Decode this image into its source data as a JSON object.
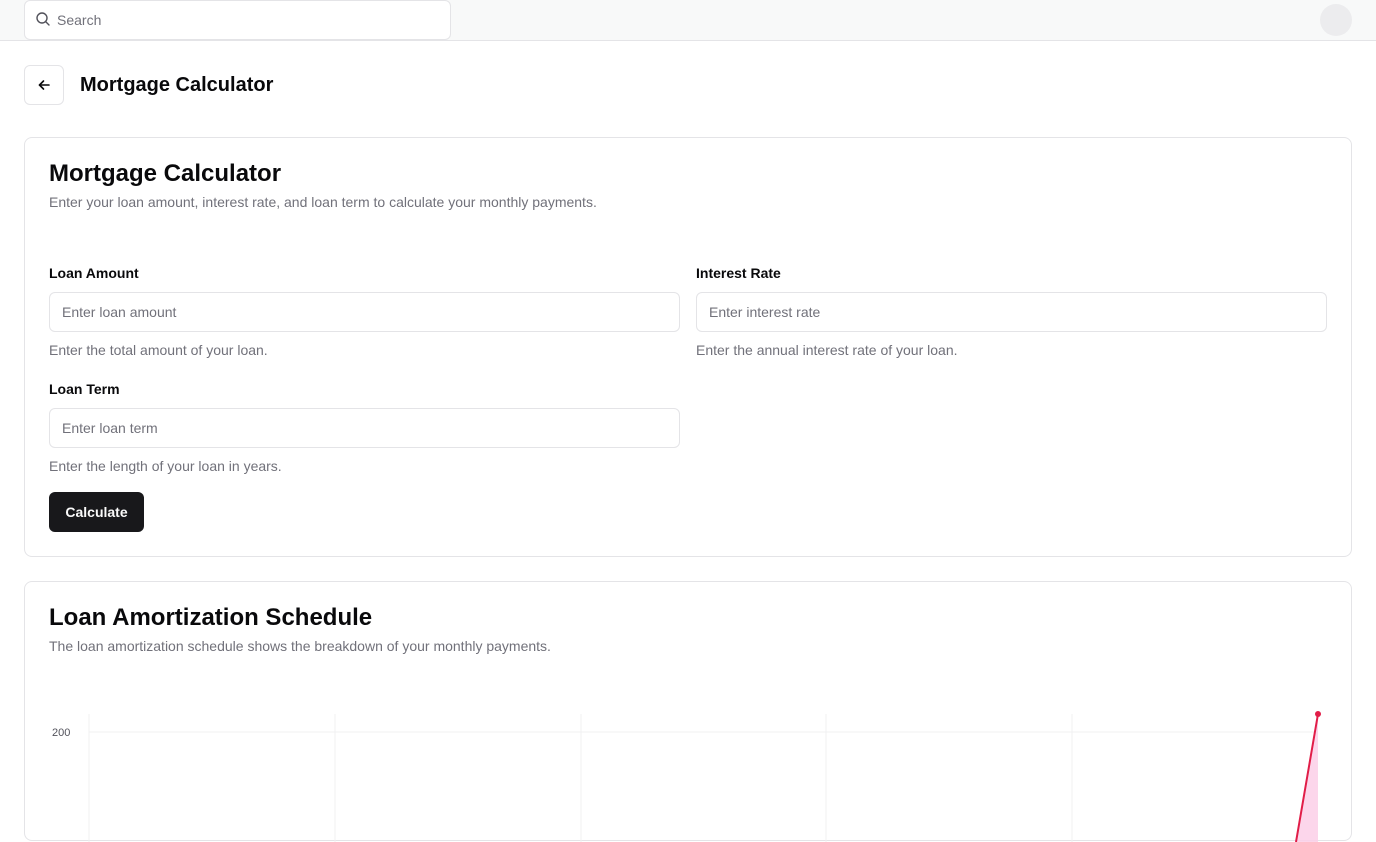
{
  "topbar": {
    "search_placeholder": "Search"
  },
  "header": {
    "title": "Mortgage Calculator"
  },
  "calculator": {
    "title": "Mortgage Calculator",
    "description": "Enter your loan amount, interest rate, and loan term to calculate your monthly payments.",
    "fields": {
      "loan_amount": {
        "label": "Loan Amount",
        "placeholder": "Enter loan amount",
        "value": "",
        "hint": "Enter the total amount of your loan."
      },
      "interest_rate": {
        "label": "Interest Rate",
        "placeholder": "Enter interest rate",
        "value": "",
        "hint": "Enter the annual interest rate of your loan."
      },
      "loan_term": {
        "label": "Loan Term",
        "placeholder": "Enter loan term",
        "value": "",
        "hint": "Enter the length of your loan in years."
      }
    },
    "calculate_label": "Calculate"
  },
  "schedule": {
    "title": "Loan Amortization Schedule",
    "description": "The loan amortization schedule shows the breakdown of your monthly payments."
  },
  "colors": {
    "primary": "#18181b",
    "muted": "#71717a",
    "border": "#e4e4e7",
    "series": "#e11d48",
    "series_fill": "#fbcfe8"
  },
  "icons": {
    "search": "search-icon",
    "back": "arrow-left-icon"
  },
  "chart_data": {
    "type": "area",
    "title": "",
    "xlabel": "",
    "ylabel": "",
    "y_ticks": [
      "200"
    ],
    "grid": true,
    "series": [
      {
        "values": [
          200
        ]
      }
    ]
  }
}
